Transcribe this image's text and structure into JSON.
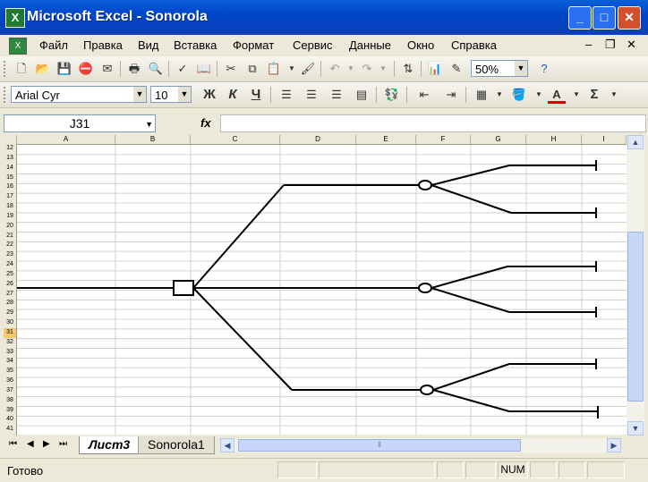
{
  "window": {
    "title": "Microsoft Excel - Sonorola",
    "minimize_label": "_",
    "maximize_label": "□",
    "close_label": "✕"
  },
  "menu": {
    "items": [
      "Файл",
      "Правка",
      "Вид",
      "Вставка",
      "Формат",
      "Сервис",
      "Данные",
      "Окно",
      "Справка"
    ],
    "doc_min": "–",
    "doc_restore": "❐",
    "doc_close": "✕"
  },
  "toolbar_standard": {
    "zoom": "50%",
    "icons": [
      "new-icon",
      "open-icon",
      "save-icon",
      "permission-icon",
      "print-icon",
      "print-preview-icon",
      "spelling-icon",
      "research-icon",
      "cut-icon",
      "copy-icon",
      "paste-icon",
      "format-painter-icon",
      "undo-icon",
      "redo-icon",
      "sort-icon",
      "chart-wizard-icon",
      "drawing-icon",
      "help-icon"
    ]
  },
  "toolbar_formatting": {
    "font_name": "Arial Cyr",
    "font_size": "10",
    "bold_label": "Ж",
    "italic_label": "К",
    "underline_label": "Ч",
    "autosum_label": "Σ"
  },
  "formula_bar": {
    "name_box": "J31",
    "fx_label": "fx",
    "value": ""
  },
  "sheet": {
    "columns": [
      "A",
      "B",
      "C",
      "D",
      "E",
      "F",
      "G",
      "H",
      "I"
    ],
    "rows": [
      "12",
      "13",
      "14",
      "15",
      "16",
      "17",
      "18",
      "19",
      "20",
      "21",
      "22",
      "23",
      "24",
      "25",
      "26",
      "27",
      "28",
      "29",
      "30",
      "31",
      "32",
      "33",
      "34",
      "35",
      "36",
      "37",
      "38",
      "39",
      "40",
      "41"
    ],
    "selected_row": "31"
  },
  "tabs": {
    "nav": [
      "⏮",
      "◀",
      "▶",
      "⏭"
    ],
    "sheets": [
      {
        "name": "Лист3",
        "active": true
      },
      {
        "name": "Sonorola1",
        "active": false
      }
    ]
  },
  "status": {
    "text": "Готово",
    "num": "NUM"
  },
  "colors": {
    "title_bar": "#0046c9",
    "selected_row_header": "#f8c870"
  }
}
